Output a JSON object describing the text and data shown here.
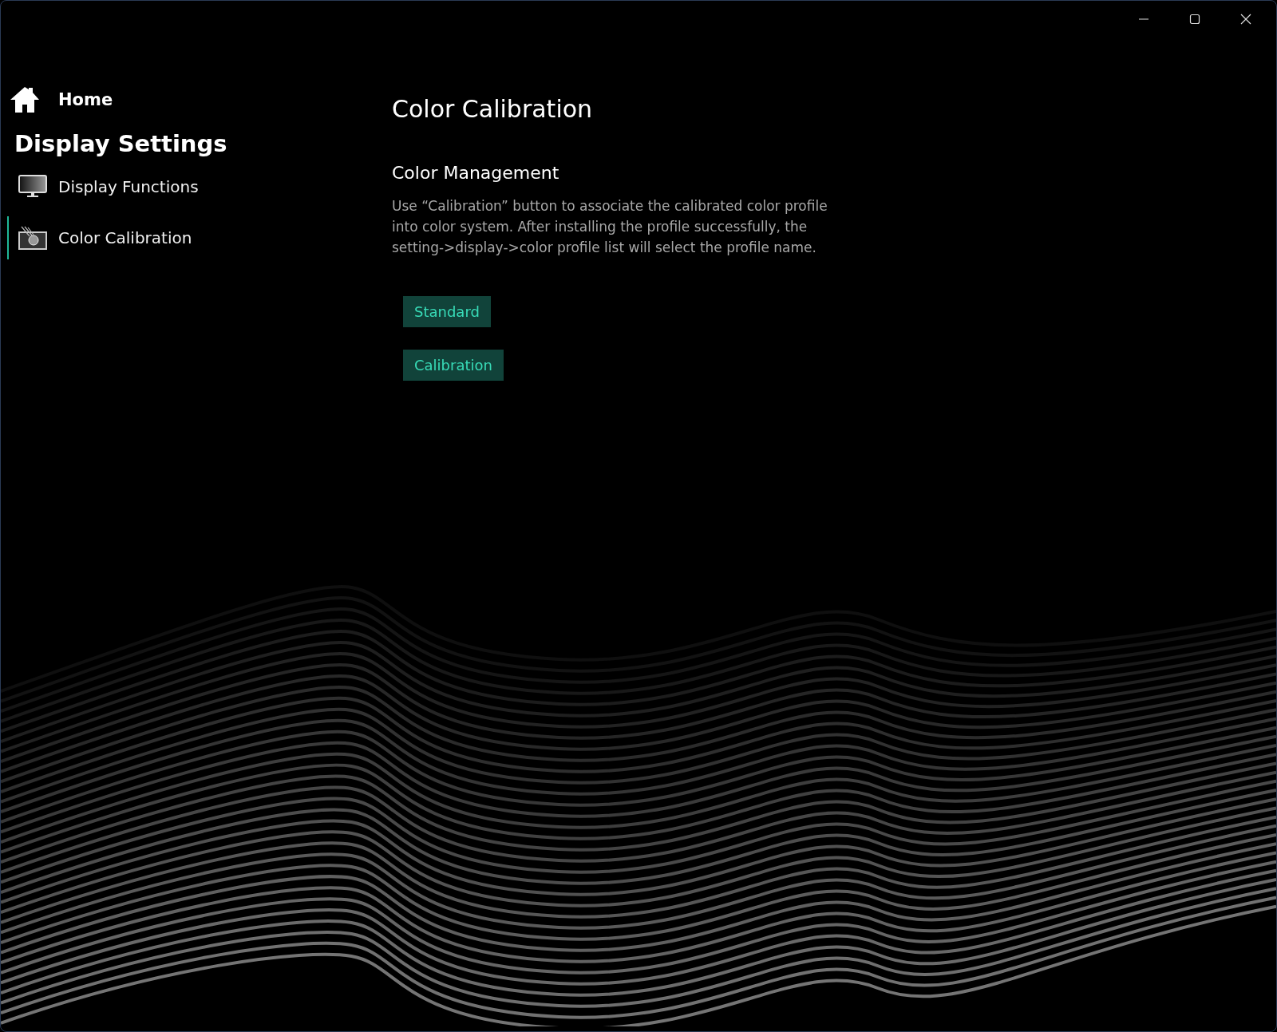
{
  "window": {
    "controls": [
      {
        "kind": "minimize"
      },
      {
        "kind": "maximize"
      },
      {
        "kind": "close"
      }
    ]
  },
  "sidebar": {
    "home": "Home",
    "title": "Display Settings",
    "items": [
      {
        "label": "Display Functions",
        "kind": "monitor",
        "selected": false
      },
      {
        "label": "Color Calibration",
        "kind": "calibration",
        "selected": true
      }
    ]
  },
  "main": {
    "title": "Color Calibration",
    "section": "Color Management",
    "description": "Use “Calibration” button to associate the calibrated color profile into color system. After installing the profile successfully, the setting->display->color profile list will select the profile name.",
    "buttons": [
      "Standard",
      "Calibration"
    ]
  }
}
